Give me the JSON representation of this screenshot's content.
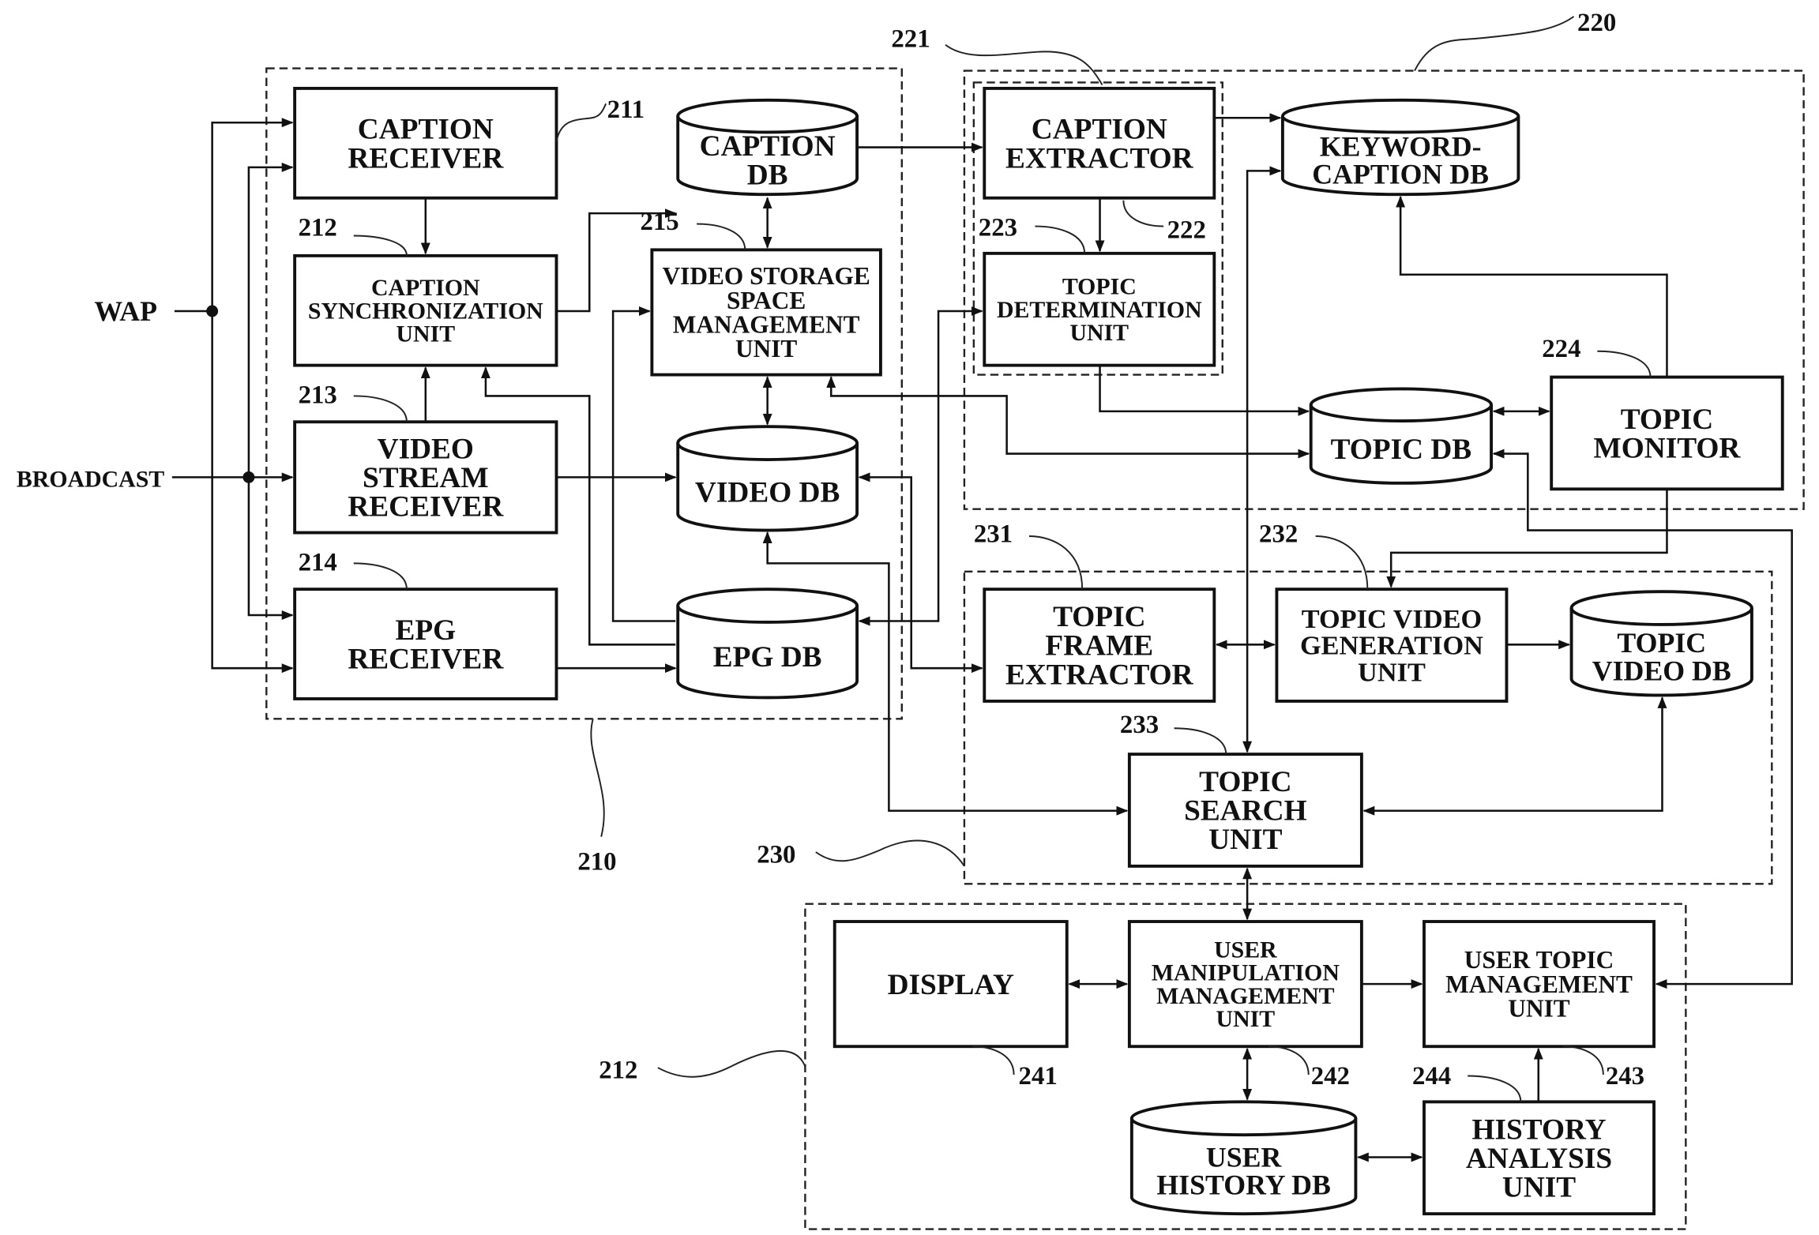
{
  "figure": {
    "inputs": {
      "wap": "WAP",
      "broadcast": "BROADCAST"
    },
    "groups": {
      "g210": {
        "ref": "210"
      },
      "g220": {
        "ref": "220"
      },
      "g221": {
        "ref": "221"
      },
      "g230": {
        "ref": "230"
      },
      "g240": {
        "ref": "212"
      }
    },
    "blocks": {
      "caption_receiver": {
        "ref": "211",
        "lines": [
          "CAPTION",
          "RECEIVER"
        ]
      },
      "caption_sync": {
        "ref": "212",
        "lines": [
          "CAPTION",
          "SYNCHRONIZATION",
          "UNIT"
        ]
      },
      "video_stream_receiver": {
        "ref": "213",
        "lines": [
          "VIDEO",
          "STREAM",
          "RECEIVER"
        ]
      },
      "epg_receiver": {
        "ref": "214",
        "lines": [
          "EPG",
          "RECEIVER"
        ]
      },
      "video_storage": {
        "ref": "215",
        "lines": [
          "VIDEO STORAGE",
          "SPACE",
          "MANAGEMENT",
          "UNIT"
        ]
      },
      "caption_extractor": {
        "ref": "222",
        "lines": [
          "CAPTION",
          "EXTRACTOR"
        ]
      },
      "topic_determination": {
        "ref": "223",
        "lines": [
          "TOPIC",
          "DETERMINATION",
          "UNIT"
        ]
      },
      "topic_monitor": {
        "ref": "224",
        "lines": [
          "TOPIC",
          "MONITOR"
        ]
      },
      "topic_frame_extractor": {
        "ref": "231",
        "lines": [
          "TOPIC",
          "FRAME",
          "EXTRACTOR"
        ]
      },
      "topic_video_generation": {
        "ref": "232",
        "lines": [
          "TOPIC VIDEO",
          "GENERATION",
          "UNIT"
        ]
      },
      "topic_search": {
        "ref": "233",
        "lines": [
          "TOPIC",
          "SEARCH",
          "UNIT"
        ]
      },
      "display": {
        "ref": "241",
        "lines": [
          "DISPLAY"
        ]
      },
      "user_manipulation": {
        "ref": "242",
        "lines": [
          "USER",
          "MANIPULATION",
          "MANAGEMENT",
          "UNIT"
        ]
      },
      "user_topic_management": {
        "ref": "243",
        "lines": [
          "USER TOPIC",
          "MANAGEMENT",
          "UNIT"
        ]
      },
      "history_analysis": {
        "ref": "244",
        "lines": [
          "HISTORY",
          "ANALYSIS",
          "UNIT"
        ]
      }
    },
    "databases": {
      "caption_db": {
        "lines": [
          "CAPTION",
          "DB"
        ]
      },
      "video_db": {
        "lines": [
          "VIDEO DB"
        ]
      },
      "epg_db": {
        "lines": [
          "EPG DB"
        ]
      },
      "keyword_caption_db": {
        "lines": [
          "KEYWORD-",
          "CAPTION DB"
        ]
      },
      "topic_db": {
        "lines": [
          "TOPIC DB"
        ]
      },
      "topic_video_db": {
        "lines": [
          "TOPIC",
          "VIDEO DB"
        ]
      },
      "user_history_db": {
        "lines": [
          "USER",
          "HISTORY DB"
        ]
      }
    }
  }
}
